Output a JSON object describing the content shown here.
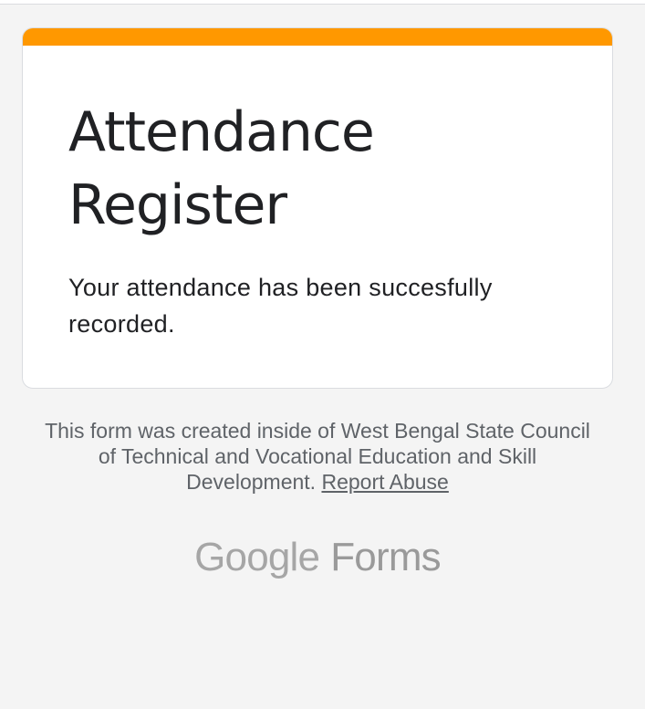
{
  "form": {
    "title": "Attendance Register",
    "confirmation_message": "Your attendance has been succesfully recorded."
  },
  "footer": {
    "disclaimer": "This form was created inside of West Bengal State Council of Technical and Vocational Education and Skill Development.",
    "report_abuse_label": "Report Abuse"
  },
  "branding": {
    "google": "Google",
    "forms": "Forms"
  },
  "colors": {
    "accent": "#ff9800",
    "page_background": "#f4f4f4",
    "card_background": "#ffffff",
    "title_text": "#202124",
    "footer_text": "#5f6368"
  }
}
